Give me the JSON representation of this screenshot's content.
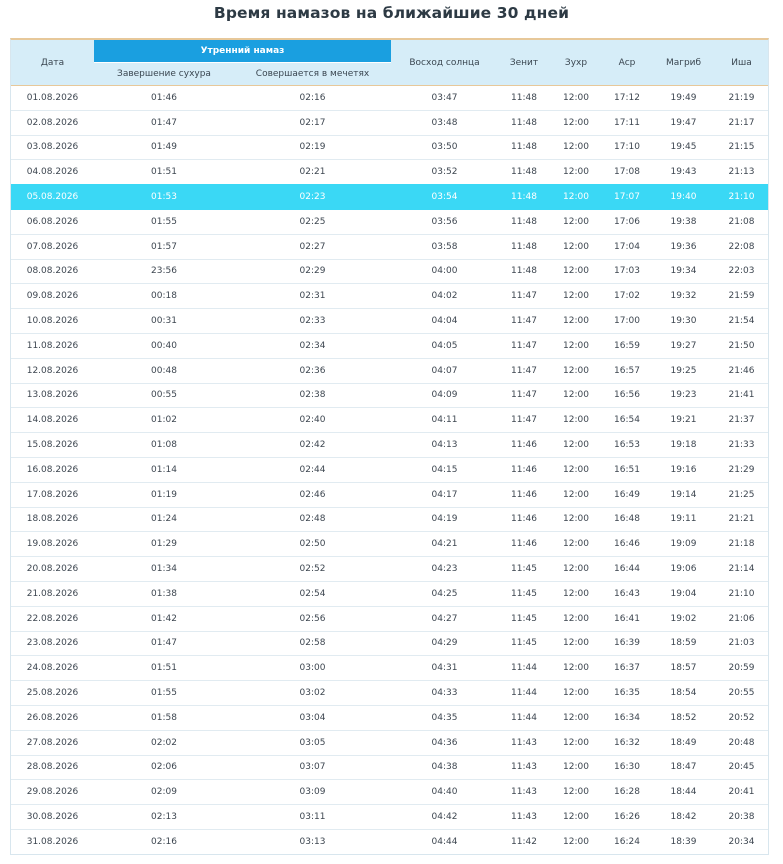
{
  "title": "Время намазов на ближайшие 30 дней",
  "headers": {
    "date": "Дата",
    "morning_group": "Утренний намаз",
    "suhur_end": "Завершение сухура",
    "mosque": "Совершается в мечетях",
    "sunrise": "Восход солнца",
    "zenith": "Зенит",
    "dhuhr": "Зухр",
    "asr": "Аср",
    "maghrib": "Магриб",
    "isha": "Иша"
  },
  "highlight_index": 4,
  "colors": {
    "highlight": "#3ad8f5",
    "group_header": "#1a9fe0",
    "header_bg": "#d6edf8"
  },
  "rows": [
    [
      "01.08.2026",
      "01:46",
      "02:16",
      "03:47",
      "11:48",
      "12:00",
      "17:12",
      "19:49",
      "21:19"
    ],
    [
      "02.08.2026",
      "01:47",
      "02:17",
      "03:48",
      "11:48",
      "12:00",
      "17:11",
      "19:47",
      "21:17"
    ],
    [
      "03.08.2026",
      "01:49",
      "02:19",
      "03:50",
      "11:48",
      "12:00",
      "17:10",
      "19:45",
      "21:15"
    ],
    [
      "04.08.2026",
      "01:51",
      "02:21",
      "03:52",
      "11:48",
      "12:00",
      "17:08",
      "19:43",
      "21:13"
    ],
    [
      "05.08.2026",
      "01:53",
      "02:23",
      "03:54",
      "11:48",
      "12:00",
      "17:07",
      "19:40",
      "21:10"
    ],
    [
      "06.08.2026",
      "01:55",
      "02:25",
      "03:56",
      "11:48",
      "12:00",
      "17:06",
      "19:38",
      "21:08"
    ],
    [
      "07.08.2026",
      "01:57",
      "02:27",
      "03:58",
      "11:48",
      "12:00",
      "17:04",
      "19:36",
      "22:08"
    ],
    [
      "08.08.2026",
      "23:56",
      "02:29",
      "04:00",
      "11:48",
      "12:00",
      "17:03",
      "19:34",
      "22:03"
    ],
    [
      "09.08.2026",
      "00:18",
      "02:31",
      "04:02",
      "11:47",
      "12:00",
      "17:02",
      "19:32",
      "21:59"
    ],
    [
      "10.08.2026",
      "00:31",
      "02:33",
      "04:04",
      "11:47",
      "12:00",
      "17:00",
      "19:30",
      "21:54"
    ],
    [
      "11.08.2026",
      "00:40",
      "02:34",
      "04:05",
      "11:47",
      "12:00",
      "16:59",
      "19:27",
      "21:50"
    ],
    [
      "12.08.2026",
      "00:48",
      "02:36",
      "04:07",
      "11:47",
      "12:00",
      "16:57",
      "19:25",
      "21:46"
    ],
    [
      "13.08.2026",
      "00:55",
      "02:38",
      "04:09",
      "11:47",
      "12:00",
      "16:56",
      "19:23",
      "21:41"
    ],
    [
      "14.08.2026",
      "01:02",
      "02:40",
      "04:11",
      "11:47",
      "12:00",
      "16:54",
      "19:21",
      "21:37"
    ],
    [
      "15.08.2026",
      "01:08",
      "02:42",
      "04:13",
      "11:46",
      "12:00",
      "16:53",
      "19:18",
      "21:33"
    ],
    [
      "16.08.2026",
      "01:14",
      "02:44",
      "04:15",
      "11:46",
      "12:00",
      "16:51",
      "19:16",
      "21:29"
    ],
    [
      "17.08.2026",
      "01:19",
      "02:46",
      "04:17",
      "11:46",
      "12:00",
      "16:49",
      "19:14",
      "21:25"
    ],
    [
      "18.08.2026",
      "01:24",
      "02:48",
      "04:19",
      "11:46",
      "12:00",
      "16:48",
      "19:11",
      "21:21"
    ],
    [
      "19.08.2026",
      "01:29",
      "02:50",
      "04:21",
      "11:46",
      "12:00",
      "16:46",
      "19:09",
      "21:18"
    ],
    [
      "20.08.2026",
      "01:34",
      "02:52",
      "04:23",
      "11:45",
      "12:00",
      "16:44",
      "19:06",
      "21:14"
    ],
    [
      "21.08.2026",
      "01:38",
      "02:54",
      "04:25",
      "11:45",
      "12:00",
      "16:43",
      "19:04",
      "21:10"
    ],
    [
      "22.08.2026",
      "01:42",
      "02:56",
      "04:27",
      "11:45",
      "12:00",
      "16:41",
      "19:02",
      "21:06"
    ],
    [
      "23.08.2026",
      "01:47",
      "02:58",
      "04:29",
      "11:45",
      "12:00",
      "16:39",
      "18:59",
      "21:03"
    ],
    [
      "24.08.2026",
      "01:51",
      "03:00",
      "04:31",
      "11:44",
      "12:00",
      "16:37",
      "18:57",
      "20:59"
    ],
    [
      "25.08.2026",
      "01:55",
      "03:02",
      "04:33",
      "11:44",
      "12:00",
      "16:35",
      "18:54",
      "20:55"
    ],
    [
      "26.08.2026",
      "01:58",
      "03:04",
      "04:35",
      "11:44",
      "12:00",
      "16:34",
      "18:52",
      "20:52"
    ],
    [
      "27.08.2026",
      "02:02",
      "03:05",
      "04:36",
      "11:43",
      "12:00",
      "16:32",
      "18:49",
      "20:48"
    ],
    [
      "28.08.2026",
      "02:06",
      "03:07",
      "04:38",
      "11:43",
      "12:00",
      "16:30",
      "18:47",
      "20:45"
    ],
    [
      "29.08.2026",
      "02:09",
      "03:09",
      "04:40",
      "11:43",
      "12:00",
      "16:28",
      "18:44",
      "20:41"
    ],
    [
      "30.08.2026",
      "02:13",
      "03:11",
      "04:42",
      "11:43",
      "12:00",
      "16:26",
      "18:42",
      "20:38"
    ],
    [
      "31.08.2026",
      "02:16",
      "03:13",
      "04:44",
      "11:42",
      "12:00",
      "16:24",
      "18:39",
      "20:34"
    ]
  ]
}
